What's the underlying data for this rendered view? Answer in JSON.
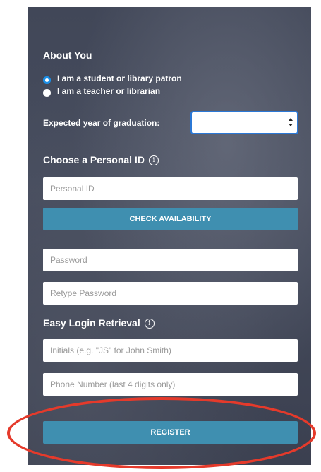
{
  "about": {
    "heading": "About You",
    "options": [
      {
        "label": "I am a student or library patron",
        "selected": true
      },
      {
        "label": "I am a teacher or librarian",
        "selected": false
      }
    ],
    "graduation_label": "Expected year of graduation:",
    "graduation_value": ""
  },
  "personal_id": {
    "heading": "Choose a Personal ID",
    "info_glyph": "i",
    "placeholder": "Personal ID",
    "check_button": "CHECK AVAILABILITY",
    "password_placeholder": "Password",
    "retype_placeholder": "Retype Password"
  },
  "retrieval": {
    "heading": "Easy Login Retrieval",
    "info_glyph": "i",
    "initials_placeholder": "Initials (e.g. \"JS\" for John Smith)",
    "phone_placeholder": "Phone Number (last 4 digits only)"
  },
  "register_button": "REGISTER",
  "colors": {
    "panel_bg": "#414758",
    "button": "#3f8fb0",
    "radio_selected": "#1c8fe6",
    "highlight_ring": "#e53a2b"
  }
}
